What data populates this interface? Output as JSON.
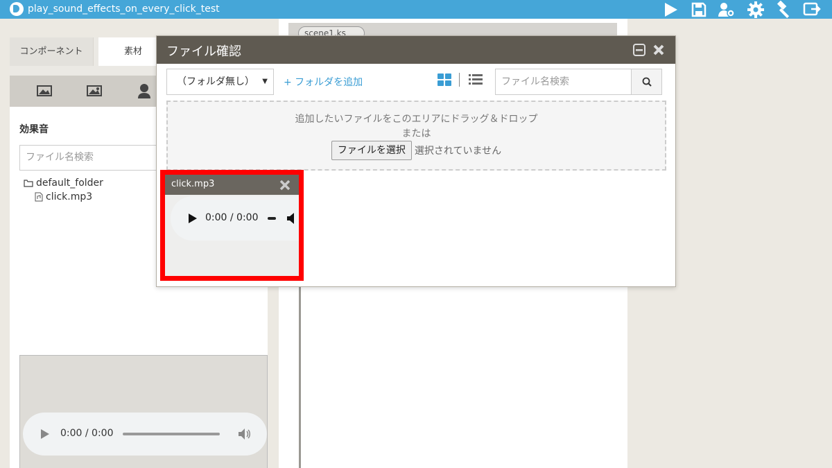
{
  "app": {
    "title": "play_sound_effects_on_every_click_test",
    "toolbar_icons": [
      "play-icon",
      "save-icon",
      "users-settings-icon",
      "gear-icon",
      "hammer-icon",
      "export-icon"
    ]
  },
  "left_panel": {
    "tabs": [
      {
        "label": "コンポーネント"
      },
      {
        "label": "素材"
      }
    ],
    "toolbar_icons": [
      "background-image-icon",
      "image-icon",
      "character-icon"
    ],
    "section_title": "効果音",
    "search_placeholder": "ファイル名検索",
    "tree": {
      "folder": "default_folder",
      "file": "click.mp3"
    },
    "preview_player": {
      "time": "0:00 / 0:00"
    }
  },
  "editor": {
    "tab_label": "scene1.ks"
  },
  "modal": {
    "title": "ファイル確認",
    "folder_select": "（フォルダ無し）",
    "add_folder": "+ フォルダを追加",
    "search_placeholder": "ファイル名検索",
    "dropzone": {
      "line1": "追加したいファイルをこのエリアにドラッグ＆ドロップ",
      "line2": "または",
      "choose_button": "ファイルを選択",
      "no_selection": "選択されていません"
    },
    "file_card": {
      "name": "click.mp3",
      "time": "0:00 / 0:00"
    }
  },
  "colors": {
    "topbar": "#45a6d8",
    "modal_header": "#5f5a51",
    "link_blue": "#3a9dd4",
    "highlight_red": "#ff0000"
  }
}
